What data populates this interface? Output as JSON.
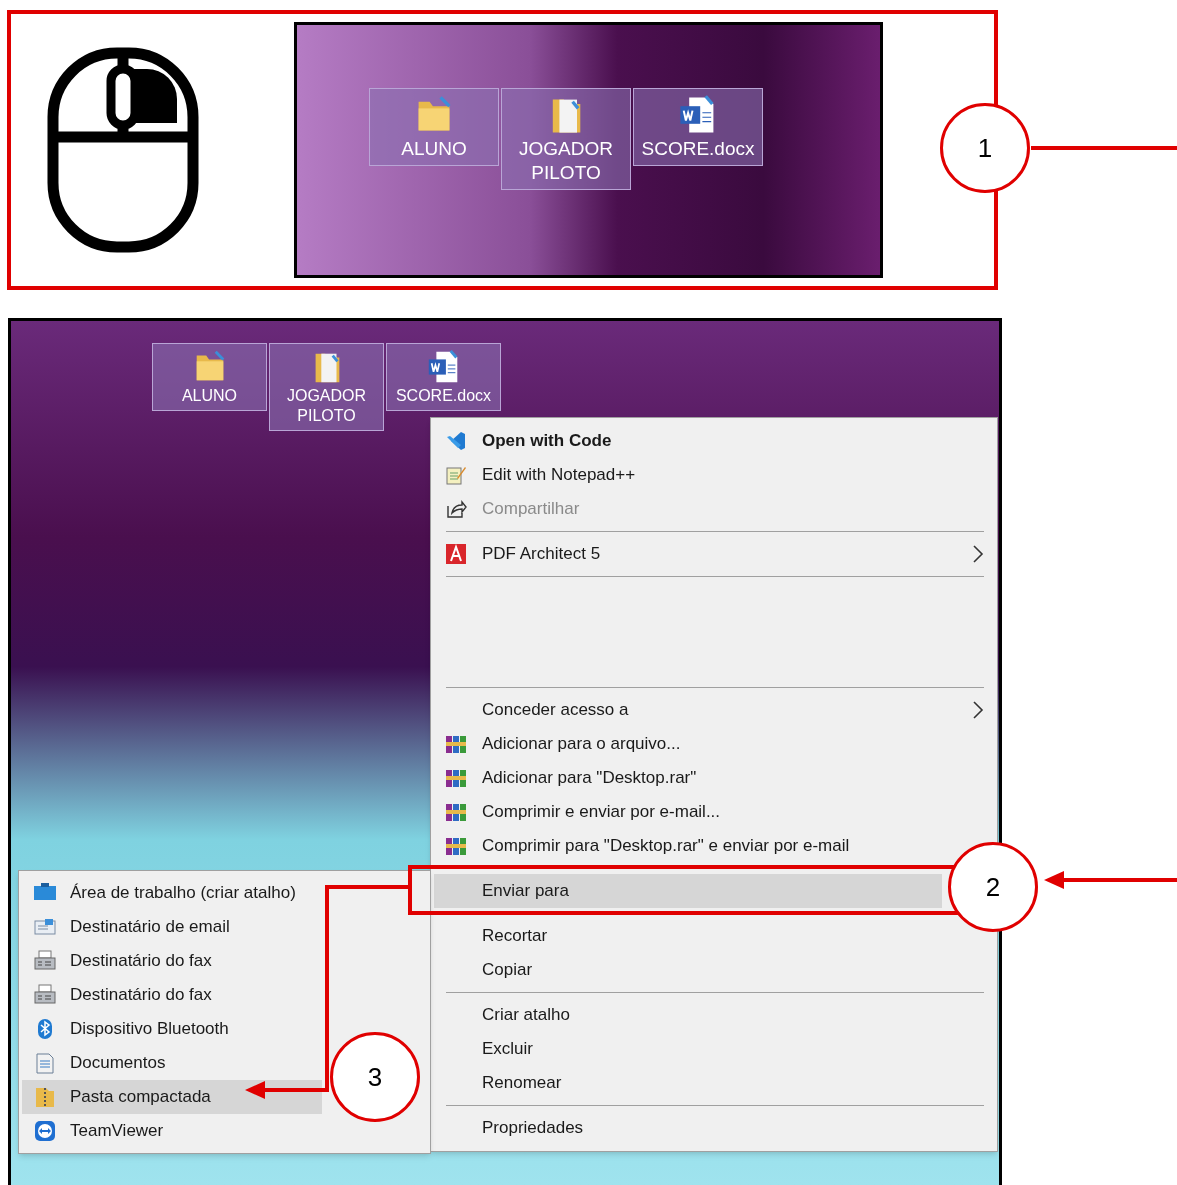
{
  "step1": {
    "callout": "1",
    "desktop_icons": [
      {
        "label": "ALUNO",
        "kind": "folder"
      },
      {
        "label": "JOGADOR PILOTO",
        "kind": "folder-doc"
      },
      {
        "label": "SCORE.docx",
        "kind": "word"
      }
    ]
  },
  "step2": {
    "desktop_icons": [
      {
        "label": "ALUNO",
        "kind": "folder"
      },
      {
        "label": "JOGADOR PILOTO",
        "kind": "folder-doc"
      },
      {
        "label": "SCORE.docx",
        "kind": "word"
      }
    ],
    "context_menu": {
      "items": [
        {
          "kind": "code",
          "label": "Open with Code",
          "bold": true,
          "disabled": false,
          "submenu": false,
          "selected": false
        },
        {
          "kind": "notepad",
          "label": "Edit with Notepad++",
          "bold": false,
          "disabled": false,
          "submenu": false,
          "selected": false
        },
        {
          "kind": "share",
          "label": "Compartilhar",
          "bold": false,
          "disabled": true,
          "submenu": false,
          "selected": false
        },
        {
          "kind": "separator"
        },
        {
          "kind": "pdf",
          "label": "PDF Architect 5",
          "bold": false,
          "disabled": false,
          "submenu": true,
          "selected": false
        },
        {
          "kind": "separator"
        },
        {
          "kind": "spacer"
        },
        {
          "kind": "separator"
        },
        {
          "kind": "plain",
          "label": "Conceder acesso a",
          "bold": false,
          "disabled": false,
          "submenu": true,
          "selected": false
        },
        {
          "kind": "archive",
          "label": "Adicionar para o arquivo...",
          "bold": false,
          "disabled": false,
          "submenu": false,
          "selected": false
        },
        {
          "kind": "archive",
          "label": "Adicionar para \"Desktop.rar\"",
          "bold": false,
          "disabled": false,
          "submenu": false,
          "selected": false
        },
        {
          "kind": "archive",
          "label": "Comprimir e enviar por e-mail...",
          "bold": false,
          "disabled": false,
          "submenu": false,
          "selected": false
        },
        {
          "kind": "archive",
          "label": "Comprimir para \"Desktop.rar\" e enviar por e-mail",
          "bold": false,
          "disabled": false,
          "submenu": false,
          "selected": false
        },
        {
          "kind": "separator"
        },
        {
          "kind": "plain",
          "label": "Enviar para",
          "bold": false,
          "disabled": false,
          "submenu": false,
          "selected": true
        },
        {
          "kind": "separator"
        },
        {
          "kind": "plain",
          "label": "Recortar",
          "bold": false,
          "disabled": false,
          "submenu": false,
          "selected": false
        },
        {
          "kind": "plain",
          "label": "Copiar",
          "bold": false,
          "disabled": false,
          "submenu": false,
          "selected": false
        },
        {
          "kind": "separator"
        },
        {
          "kind": "plain",
          "label": "Criar atalho",
          "bold": false,
          "disabled": false,
          "submenu": false,
          "selected": false
        },
        {
          "kind": "plain",
          "label": "Excluir",
          "bold": false,
          "disabled": false,
          "submenu": false,
          "selected": false
        },
        {
          "kind": "plain",
          "label": "Renomear",
          "bold": false,
          "disabled": false,
          "submenu": false,
          "selected": false
        },
        {
          "kind": "separator"
        },
        {
          "kind": "plain",
          "label": "Propriedades",
          "bold": false,
          "disabled": false,
          "submenu": false,
          "selected": false
        }
      ]
    },
    "send_to_menu": {
      "items": [
        {
          "kind": "desktop",
          "label": "Área de trabalho (criar atalho)",
          "selected": false
        },
        {
          "kind": "mail",
          "label": "Destinatário de email",
          "selected": false
        },
        {
          "kind": "fax",
          "label": "Destinatário do fax",
          "selected": false
        },
        {
          "kind": "fax",
          "label": "Destinatário do fax",
          "selected": false
        },
        {
          "kind": "bluetooth",
          "label": "Dispositivo Bluetooth",
          "selected": false
        },
        {
          "kind": "document",
          "label": "Documentos",
          "selected": false
        },
        {
          "kind": "zip",
          "label": "Pasta compactada",
          "selected": true
        },
        {
          "kind": "teamviewer",
          "label": "TeamViewer",
          "selected": false
        }
      ]
    },
    "callouts": [
      "2",
      "3"
    ]
  }
}
